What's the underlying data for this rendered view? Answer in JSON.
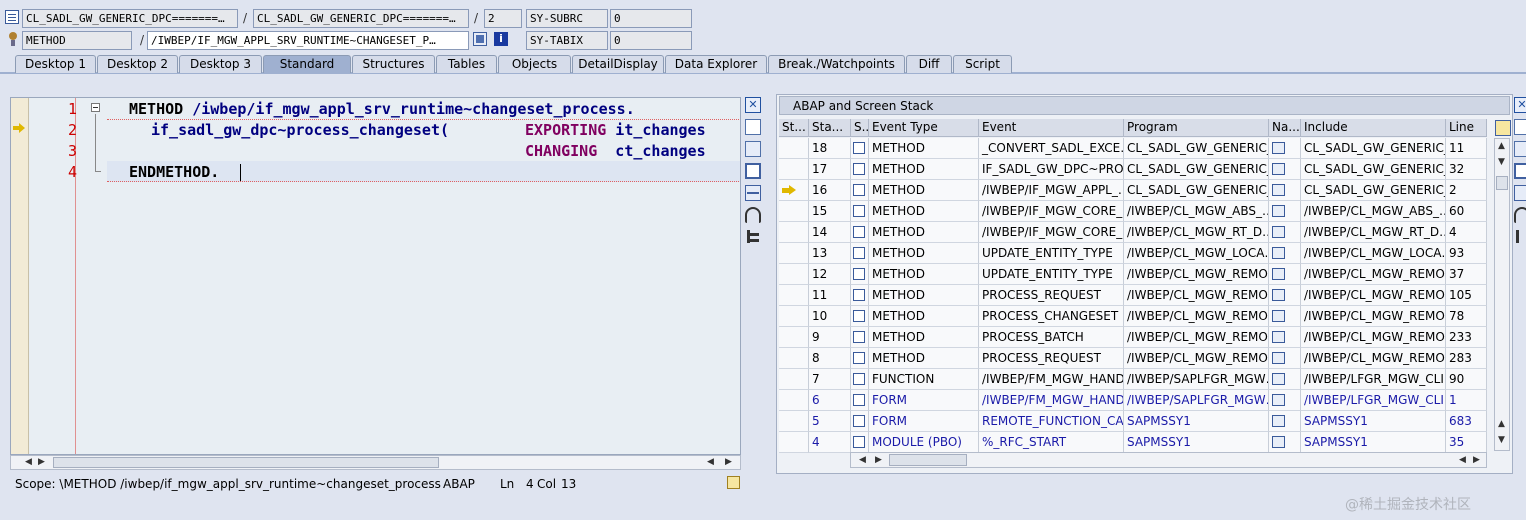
{
  "header": {
    "row1": {
      "class_name": "CL_SADL_GW_GENERIC_DPC=======…",
      "class_name_2": "CL_SADL_GW_GENERIC_DPC=======…",
      "separator": "/",
      "level": "2",
      "sysvar_name": "SY-SUBRC",
      "sysvar_value": "0"
    },
    "row2": {
      "event_type": "METHOD",
      "method_name": "/IWBEP/IF_MGW_APPL_SRV_RUNTIME~CHANGESET_P…",
      "sysvar_name": "SY-TABIX",
      "sysvar_value": "0"
    }
  },
  "tabs": [
    "Desktop 1",
    "Desktop 2",
    "Desktop 3",
    "Standard",
    "Structures",
    "Tables",
    "Objects",
    "DetailDisplay",
    "Data Explorer",
    "Break./Watchpoints",
    "Diff",
    "Script"
  ],
  "active_tab": "Standard",
  "code": {
    "line_numbers": [
      "1",
      "2",
      "3",
      "4"
    ],
    "l1_kw": "METHOD",
    "l1_rest": " /iwbep/if_mgw_appl_srv_runtime~changeset_process.",
    "l2_a": "if_sadl_gw_dpc~process_changeset(",
    "l2_kw": "EXPORTING",
    "l2_b": " it_changes",
    "l3_kw": "CHANGING",
    "l3_b": "  ct_changes",
    "l4_kw": "ENDMETHOD."
  },
  "status_bar": {
    "scope": "Scope: \\METHOD /iwbep/if_mgw_appl_srv_runtime~changeset_process",
    "language": "ABAP",
    "ln_label": "Ln",
    "ln_value": "4",
    "col_label": "Col",
    "col_value": "13"
  },
  "stack": {
    "title": "ABAP and Screen Stack",
    "columns": [
      "St...",
      "Sta...",
      "S...",
      "Event Type",
      "Event",
      "Program",
      "Na...",
      "Include",
      "Line"
    ],
    "rows": [
      {
        "level": "18",
        "type": "METHOD",
        "event": "_CONVERT_SADL_EXCE…",
        "program": "CL_SADL_GW_GENERIC_…",
        "include": "CL_SADL_GW_GENERIC_…",
        "line": "11"
      },
      {
        "level": "17",
        "type": "METHOD",
        "event": "IF_SADL_GW_DPC~PRO…",
        "program": "CL_SADL_GW_GENERIC_…",
        "include": "CL_SADL_GW_GENERIC_…",
        "line": "32"
      },
      {
        "level": "16",
        "type": "METHOD",
        "event": "/IWBEP/IF_MGW_APPL_…",
        "program": "CL_SADL_GW_GENERIC_…",
        "include": "CL_SADL_GW_GENERIC_…",
        "line": "2"
      },
      {
        "level": "15",
        "type": "METHOD",
        "event": "/IWBEP/IF_MGW_CORE_…",
        "program": "/IWBEP/CL_MGW_ABS_…",
        "include": "/IWBEP/CL_MGW_ABS_…",
        "line": "60"
      },
      {
        "level": "14",
        "type": "METHOD",
        "event": "/IWBEP/IF_MGW_CORE_…",
        "program": "/IWBEP/CL_MGW_RT_D…",
        "include": "/IWBEP/CL_MGW_RT_D…",
        "line": "4"
      },
      {
        "level": "13",
        "type": "METHOD",
        "event": "UPDATE_ENTITY_TYPE",
        "program": "/IWBEP/CL_MGW_LOCA…",
        "include": "/IWBEP/CL_MGW_LOCA…",
        "line": "93"
      },
      {
        "level": "12",
        "type": "METHOD",
        "event": "UPDATE_ENTITY_TYPE",
        "program": "/IWBEP/CL_MGW_REMO…",
        "include": "/IWBEP/CL_MGW_REMO…",
        "line": "37"
      },
      {
        "level": "11",
        "type": "METHOD",
        "event": "PROCESS_REQUEST",
        "program": "/IWBEP/CL_MGW_REMO…",
        "include": "/IWBEP/CL_MGW_REMO…",
        "line": "105"
      },
      {
        "level": "10",
        "type": "METHOD",
        "event": "PROCESS_CHANGESET",
        "program": "/IWBEP/CL_MGW_REMO…",
        "include": "/IWBEP/CL_MGW_REMO…",
        "line": "78"
      },
      {
        "level": "9",
        "type": "METHOD",
        "event": "PROCESS_BATCH",
        "program": "/IWBEP/CL_MGW_REMO…",
        "include": "/IWBEP/CL_MGW_REMO…",
        "line": "233"
      },
      {
        "level": "8",
        "type": "METHOD",
        "event": "PROCESS_REQUEST",
        "program": "/IWBEP/CL_MGW_REMO…",
        "include": "/IWBEP/CL_MGW_REMO…",
        "line": "283"
      },
      {
        "level": "7",
        "type": "FUNCTION",
        "event": "/IWBEP/FM_MGW_HAND…",
        "program": "/IWBEP/SAPLFGR_MGW…",
        "include": "/IWBEP/LFGR_MGW_CLI…",
        "line": "90"
      },
      {
        "level": "6",
        "type": "FORM",
        "event": "/IWBEP/FM_MGW_HAND…",
        "program": "/IWBEP/SAPLFGR_MGW…",
        "include": "/IWBEP/LFGR_MGW_CLI…",
        "line": "1"
      },
      {
        "level": "5",
        "type": "FORM",
        "event": "REMOTE_FUNCTION_CA…",
        "program": "SAPMSSY1",
        "include": "SAPMSSY1",
        "line": "683"
      },
      {
        "level": "4",
        "type": "MODULE (PBO)",
        "event": "%_RFC_START",
        "program": "SAPMSSY1",
        "include": "SAPMSSY1",
        "line": "35"
      }
    ]
  },
  "watermark": "@稀土掘金技术社区",
  "colors": {
    "background": "#dfe4f0",
    "active_tab": "#9fb0d0",
    "keyword": "#000080",
    "keyword2": "#800060",
    "line_number": "#cc0000"
  }
}
